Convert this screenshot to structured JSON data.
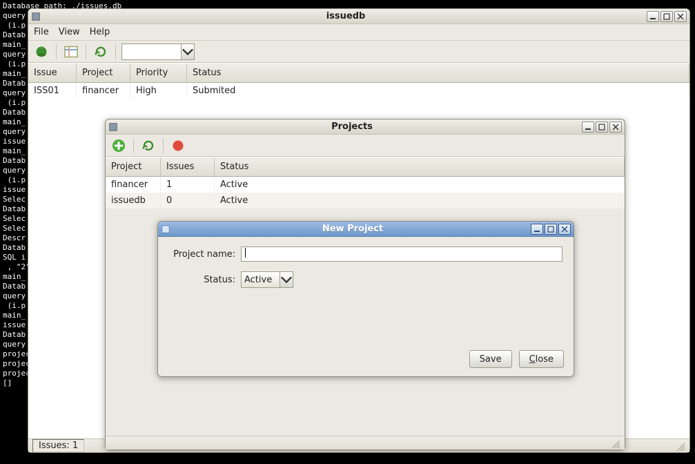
{
  "terminal": {
    "lines": "Database path: ./issues.db\nquery\n (i.p\nDatab\nmain_\nquery\n (i.p\nmain_\nDatab\nquery\n (i.p\nDatab\nmain_\nquery\nissue\nmain_\nDatab\nquery\n (i.p\nissue\nSelec\nDatab\nSelec\nSelec\nDescr\nDatab\nSQL i\n , \"2\"\nmain_\nDatab\nquery\n (i.p\nmain_\nissue\nDatab\nquery\nprojec\nprojec\nproject_main_dia\n[]"
  },
  "mainWindow": {
    "title": "issuedb",
    "menu": [
      "File",
      "View",
      "Help"
    ],
    "columns": {
      "c0": "Issue",
      "c1": "Project",
      "c2": "Priority",
      "c3": "Status"
    },
    "row0": {
      "c0": "ISS01",
      "c1": "financer",
      "c2": "High",
      "c3": "Submited"
    },
    "status": "Issues: 1"
  },
  "projectsWindow": {
    "title": "Projects",
    "columns": {
      "c0": "Project",
      "c1": "Issues",
      "c2": "Status"
    },
    "rows": {
      "r0": {
        "c0": "financer",
        "c1": "1",
        "c2": "Active"
      },
      "r1": {
        "c0": "issuedb",
        "c1": "0",
        "c2": "Active"
      }
    }
  },
  "newProjectDialog": {
    "title": "New Project",
    "labels": {
      "name": "Project name:",
      "status": "Status:"
    },
    "name_value": "",
    "status_value": "Active",
    "buttons": {
      "save": "Save",
      "close": "Close"
    }
  }
}
